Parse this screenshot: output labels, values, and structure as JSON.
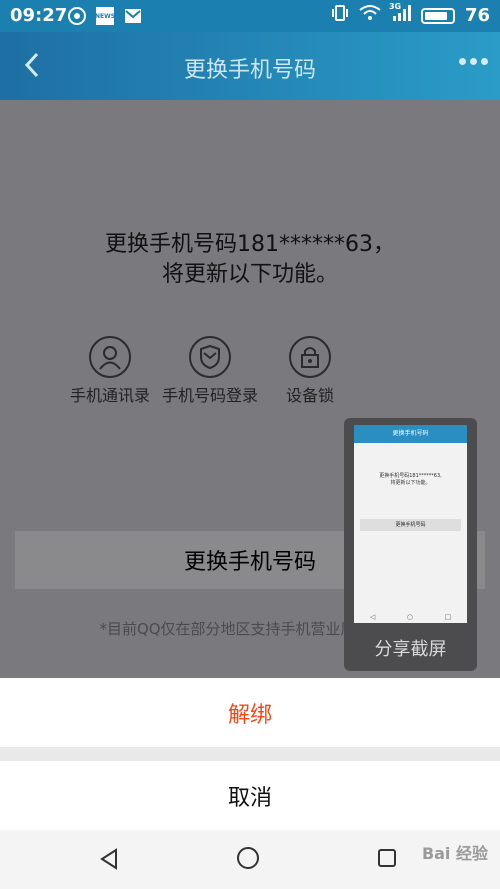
{
  "status": {
    "time": "09:27",
    "network": "3G",
    "battery": "76",
    "news_label": "NEWS"
  },
  "header": {
    "title": "更换手机号码"
  },
  "main": {
    "headline_line1": "更换手机号码181******63，",
    "headline_line2": "将更新以下功能。",
    "features": [
      {
        "label": "手机通讯录",
        "icon": "contacts-icon"
      },
      {
        "label": "手机号码登录",
        "icon": "shield-icon"
      },
      {
        "label": "设备锁",
        "icon": "lock-icon"
      }
    ],
    "change_button": "更换手机号码",
    "note": "*目前QQ仅在部分地区支持手机营业厅功能。"
  },
  "screenshot_popup": {
    "label": "分享截屏",
    "mini_title": "更换手机号码",
    "mini_text_line1": "更换手机号码181******63,",
    "mini_text_line2": "将更新以下功能。",
    "mini_button": "更换手机号码"
  },
  "sheet": {
    "unbind": "解绑",
    "cancel": "取消"
  },
  "watermark": "Bai 经验",
  "colors": {
    "titlebar": "#1e6fa3",
    "unbind": "#ef4a1a",
    "overlay": "#7a7a7e"
  }
}
